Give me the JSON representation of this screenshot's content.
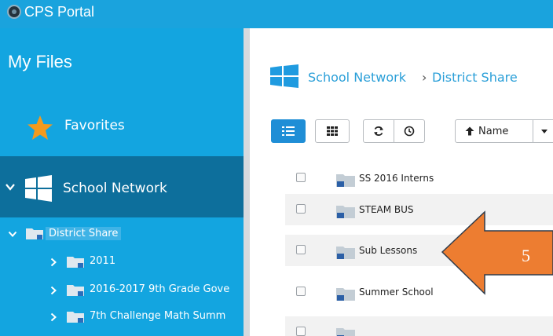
{
  "header": {
    "app_title": "CPS Portal",
    "logo_icon": "cps-seal-icon"
  },
  "sidebar": {
    "title": "My Files",
    "favorites_label": "Favorites",
    "school_network_label": "School Network",
    "tree": [
      {
        "label": "District Share",
        "expanded": true,
        "selected": true
      },
      {
        "label": "2011"
      },
      {
        "label": "2016-2017 9th Grade Gove"
      },
      {
        "label": "7th Challenge Math Summ"
      }
    ]
  },
  "breadcrumb": {
    "root": "School Network",
    "separator": "›",
    "current": "District Share"
  },
  "toolbar": {
    "sort_label": "Name"
  },
  "files": [
    {
      "name": "SS 2016 Interns"
    },
    {
      "name": "STEAM BUS"
    },
    {
      "name": "Sub Lessons"
    },
    {
      "name": "Summer School"
    },
    {
      "name": ""
    }
  ],
  "annotation": {
    "label": "5",
    "color": "#ed7d31"
  }
}
